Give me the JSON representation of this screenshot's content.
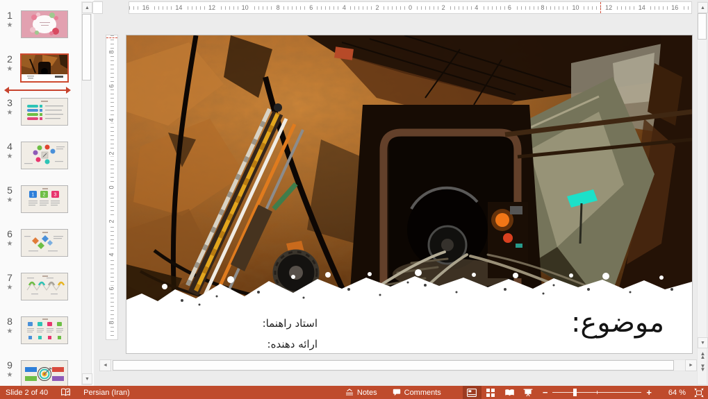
{
  "rulers": {
    "horizontal": [
      "16",
      "14",
      "12",
      "10",
      "8",
      "6",
      "4",
      "2",
      "0",
      "2",
      "4",
      "6",
      "8",
      "10",
      "12",
      "14",
      "16"
    ],
    "vertical": [
      "8",
      "6",
      "4",
      "2",
      "0",
      "2",
      "4",
      "6",
      "8"
    ]
  },
  "icons": {
    "animation_star": "★"
  },
  "thumbnail_panel": {
    "slides": [
      {
        "number": "1",
        "content": "floral-wreath-title-slide"
      },
      {
        "number": "2",
        "content": "mine-tunnel-photo-slide",
        "selected": true
      },
      {
        "number": "3",
        "content": "colored-bars-list-infographic"
      },
      {
        "number": "4",
        "content": "circular-cycle-diagram"
      },
      {
        "number": "5",
        "content": "three-numbered-tags-infographic"
      },
      {
        "number": "6",
        "content": "diamond-shapes-diagram"
      },
      {
        "number": "7",
        "content": "zigzag-timeline-infographic"
      },
      {
        "number": "8",
        "content": "four-column-grid-infographic"
      },
      {
        "number": "9",
        "content": "dartboard-target-diagram"
      }
    ]
  },
  "slide": {
    "title": "موضوع:",
    "supervisor_label": "استاد راهنما:",
    "presenter_label": "ارائه دهنده:"
  },
  "status_bar": {
    "slide_indicator": "Slide 2 of 40",
    "language": "Persian (Iran)",
    "notes_label": "Notes",
    "comments_label": "Comments",
    "zoom_level": "64 %",
    "accent_color": "#BF4B2C"
  }
}
